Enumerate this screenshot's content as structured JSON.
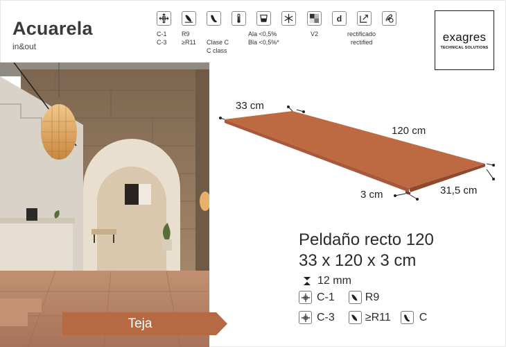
{
  "header": {
    "title": "Acuarela",
    "subtitle": "in&out"
  },
  "brand": {
    "name": "exagres",
    "tagline": "TECHNICAL SOLUTIONS"
  },
  "specs": {
    "icons": [
      {
        "name": "frost-resistance-icon"
      },
      {
        "name": "slip-resistance-icon"
      },
      {
        "name": "footprint-icon"
      },
      {
        "name": "thermometer-icon"
      },
      {
        "name": "water-absorption-icon"
      },
      {
        "name": "snowflake-icon"
      },
      {
        "name": "shade-variation-icon"
      },
      {
        "name": "d-icon"
      },
      {
        "name": "rectified-icon"
      },
      {
        "name": "clip-icon"
      }
    ],
    "col1_line1": "C-1",
    "col1_line2": "C-3",
    "col2_line1": "R9",
    "col2_line2": "≥R11",
    "col3_line1": "Clase C",
    "col3_line2": "C class",
    "col4_line1": "Ala <0,5%",
    "col4_line2": "Bla <0,5%*",
    "col5_line1": "V2",
    "col6_line1": "rectificado",
    "col6_line2": "rectified"
  },
  "color": {
    "label": "Teja",
    "tab_color": "#b56a44"
  },
  "diagram": {
    "depth": "33 cm",
    "length": "120 cm",
    "thickness": "3 cm",
    "nose": "31,5 cm",
    "step_color": "#b9643d"
  },
  "product": {
    "name": "Peldaño recto 120",
    "dimensions": "33 x 120 x 3 cm",
    "thickness": "12 mm",
    "row2_a": "C-1",
    "row2_b": "R9",
    "row3_a": "C-3",
    "row3_b": "≥R11",
    "row3_c": "C"
  }
}
